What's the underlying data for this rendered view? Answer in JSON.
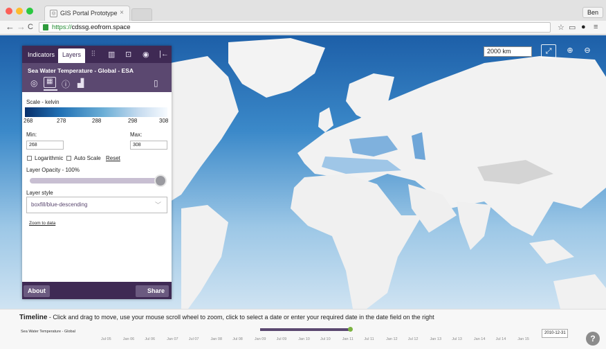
{
  "browser": {
    "tab_title": "GIS Portal Prototype",
    "tab_close": "×",
    "user": "Ben",
    "url_scheme": "https://",
    "url_host": "cdssg.eofrom.space"
  },
  "map": {
    "scale_value": "2000 km"
  },
  "panel": {
    "tabs": [
      "Indicators",
      "Layers"
    ],
    "layer_title": "Sea Water Temperature - Global - ESA",
    "scale_label": "Scale - kelvin",
    "ticks": [
      "268",
      "278",
      "288",
      "298",
      "308"
    ],
    "min_label": "Min:",
    "max_label": "Max:",
    "min_value": "268",
    "max_value": "308",
    "logarithmic_label": "Logarithmic",
    "auto_scale_label": "Auto Scale",
    "reset_label": "Reset",
    "opacity_label": "Layer Opacity - 100%",
    "opacity_fraction": 1.0,
    "style_label": "Layer style",
    "style_value": "boxfill/blue-descending",
    "zoom_link": "Zoom to data",
    "about_label": "About",
    "share_label": "Share"
  },
  "timeline": {
    "title": "Timeline",
    "instructions": " - Click and drag to move, use your mouse scroll wheel to zoom, click to select a date or enter your required date in the date field on the right",
    "layer_name": "Sea Water Temperature - Global",
    "date_value": "2010-12-31",
    "axis_labels": [
      "Jul 05",
      "Jan 06",
      "Jul 06",
      "Jan 07",
      "Jul 07",
      "Jan 08",
      "Jul 08",
      "Jan 09",
      "Jul 09",
      "Jan 10",
      "Jul 10",
      "Jan 11",
      "Jul 11",
      "Jan 12",
      "Jul 12",
      "Jan 13",
      "Jul 13",
      "Jan 14",
      "Jul 14",
      "Jan 15"
    ]
  },
  "colors": {
    "panel_dark": "#3f2a54",
    "panel_mid": "#5b4870",
    "ocean": "#3d86c6",
    "land": "#f2f2f2"
  }
}
